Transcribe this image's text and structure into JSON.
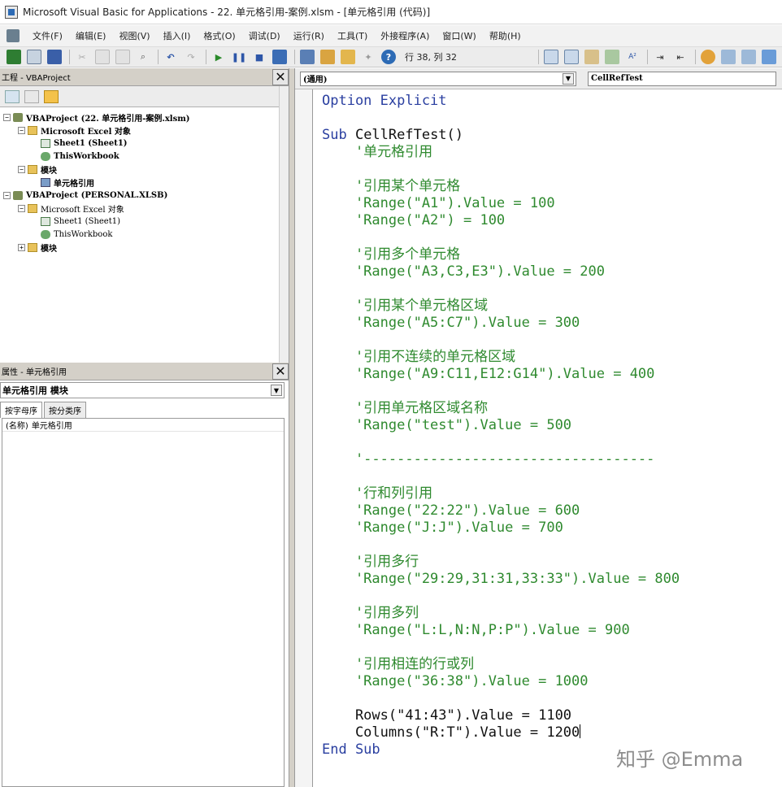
{
  "window": {
    "title": "Microsoft Visual Basic for Applications - 22. 单元格引用-案例.xlsm - [单元格引用 (代码)]"
  },
  "menu": {
    "items": [
      "文件(F)",
      "编辑(E)",
      "视图(V)",
      "插入(I)",
      "格式(O)",
      "调试(D)",
      "运行(R)",
      "工具(T)",
      "外接程序(A)",
      "窗口(W)",
      "帮助(H)"
    ]
  },
  "toolbar": {
    "position": "行 38, 列 32"
  },
  "project": {
    "title": "工程 - VBAProject",
    "close": "✕",
    "tree": {
      "proj1": "VBAProject (22. 单元格引用-案例.xlsm)",
      "excel_objects1": "Microsoft Excel 对象",
      "sheet1_1": "Sheet1 (Sheet1)",
      "thisworkbook1": "ThisWorkbook",
      "modules1": "模块",
      "module_cellref": "单元格引用",
      "proj2": "VBAProject (PERSONAL.XLSB)",
      "excel_objects2": "Microsoft Excel 对象",
      "sheet1_2": "Sheet1 (Sheet1)",
      "thisworkbook2": "ThisWorkbook",
      "modules2": "模块"
    }
  },
  "properties": {
    "title": "属性 - 单元格引用",
    "close": "✕",
    "object_select": "单元格引用 模块",
    "tabs": [
      "按字母序",
      "按分类序"
    ],
    "rows": [
      {
        "name": "(名称)",
        "value": "单元格引用"
      }
    ]
  },
  "code": {
    "object_combo": "(通用)",
    "proc_combo": "CellRefTest",
    "lines": {
      "l1": "Option Explicit",
      "l2a": "Sub",
      "l2b": " CellRefTest()",
      "l3": "    '单元格引用",
      "l4": "    '引用某个单元格",
      "l5": "    'Range(\"A1\").Value = 100",
      "l6": "    'Range(\"A2\") = 100",
      "l7": "    '引用多个单元格",
      "l8": "    'Range(\"A3,C3,E3\").Value = 200",
      "l9": "    '引用某个单元格区域",
      "l10": "    'Range(\"A5:C7\").Value = 300",
      "l11": "    '引用不连续的单元格区域",
      "l12": "    'Range(\"A9:C11,E12:G14\").Value = 400",
      "l13": "    '引用单元格区域名称",
      "l14": "    'Range(\"test\").Value = 500",
      "l15": "    '-----------------------------------",
      "l16": "    '行和列引用",
      "l17": "    'Range(\"22:22\").Value = 600",
      "l18": "    'Range(\"J:J\").Value = 700",
      "l19": "    '引用多行",
      "l20": "    'Range(\"29:29,31:31,33:33\").Value = 800",
      "l21": "    '引用多列",
      "l22": "    'Range(\"L:L,N:N,P:P\").Value = 900",
      "l23": "    '引用相连的行或列",
      "l24": "    'Range(\"36:38\").Value = 1000",
      "l25": "    Rows(\"41:43\").Value = 1100",
      "l26": "    Columns(\"R:T\").Value = 1200",
      "l27": "End Sub"
    }
  },
  "watermark": "知乎 @Emma",
  "colors": {
    "keyword": "#2a3fa0",
    "comment": "#2f8a2f"
  }
}
